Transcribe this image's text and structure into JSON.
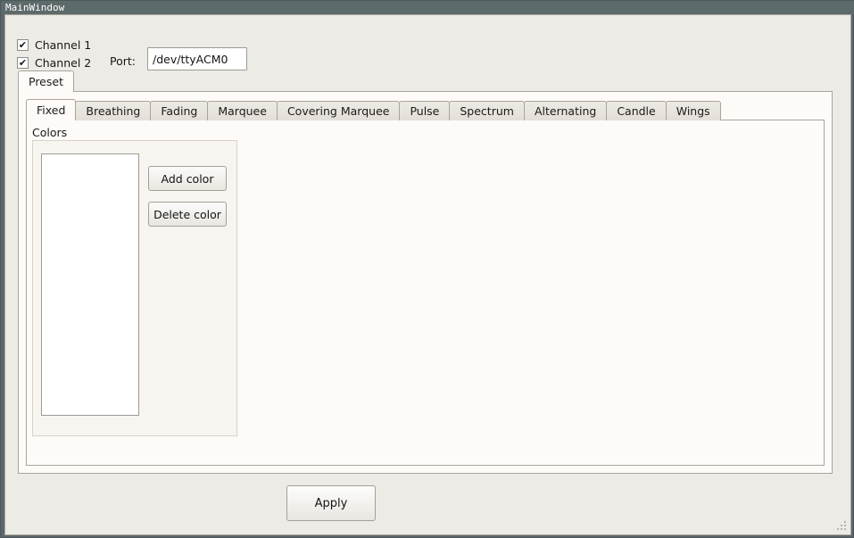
{
  "window": {
    "title": "MainWindow"
  },
  "controls": {
    "channel1": {
      "label": "Channel 1",
      "checked": true,
      "check_glyph": "✔"
    },
    "channel2": {
      "label": "Channel 2",
      "checked": true,
      "check_glyph": "✔"
    },
    "port": {
      "label": "Port:",
      "value": "/dev/ttyACM0",
      "placeholder": ""
    }
  },
  "preset_tabs": {
    "items": [
      {
        "label": "Preset",
        "selected": true
      }
    ]
  },
  "effect_tabs": {
    "selected": "Fixed",
    "items": [
      {
        "label": "Fixed",
        "selected": true
      },
      {
        "label": "Breathing",
        "selected": false
      },
      {
        "label": "Fading",
        "selected": false
      },
      {
        "label": "Marquee",
        "selected": false
      },
      {
        "label": "Covering Marquee",
        "selected": false
      },
      {
        "label": "Pulse",
        "selected": false
      },
      {
        "label": "Spectrum",
        "selected": false
      },
      {
        "label": "Alternating",
        "selected": false
      },
      {
        "label": "Candle",
        "selected": false
      },
      {
        "label": "Wings",
        "selected": false
      }
    ]
  },
  "colors_group": {
    "title": "Colors",
    "list_items": [],
    "add_button": "Add color",
    "delete_button": "Delete color"
  },
  "footer": {
    "apply_button": "Apply"
  },
  "colors": {
    "titlebar_bg": "#5d6a6a",
    "titlebar_text": "#ffffff",
    "window_bg": "#edebe6",
    "pane_bg": "#fdfaf8",
    "tab_bg": "#e7e3dd",
    "border": "#a9a59e",
    "field_bg": "#ffffff",
    "text": "#171717"
  }
}
